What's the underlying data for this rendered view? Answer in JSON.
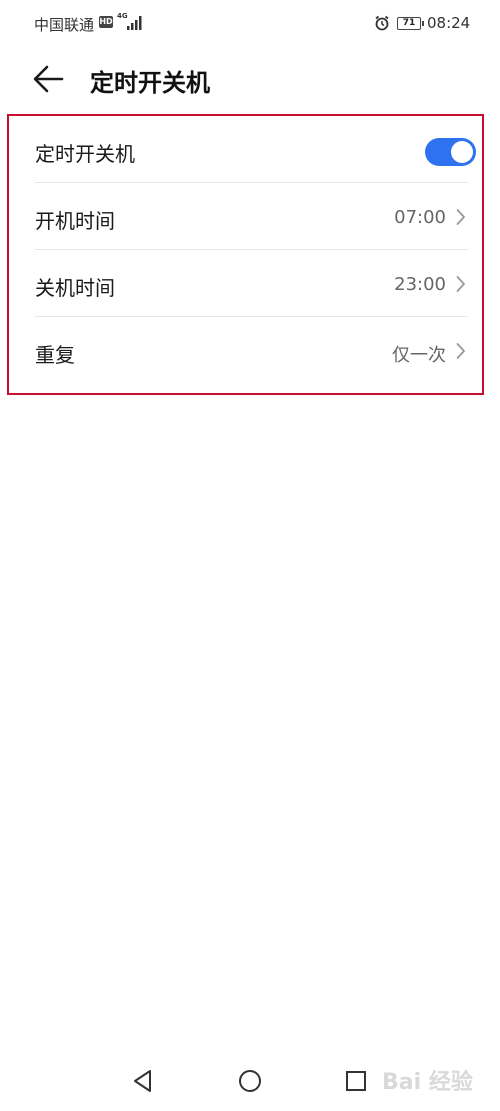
{
  "status_bar": {
    "carrier": "中国联通",
    "hd_badge": "HD",
    "network_type": "4G",
    "battery_level": "71",
    "time": "08:24",
    "icons": [
      "signal-icon",
      "alarm-icon",
      "battery-icon"
    ]
  },
  "header": {
    "title": "定时开关机",
    "back_icon": "arrow-left-icon"
  },
  "settings": {
    "items": [
      {
        "label": "定时开关机",
        "control": "toggle",
        "enabled": true
      },
      {
        "label": "开机时间",
        "value": "07:00"
      },
      {
        "label": "关机时间",
        "value": "23:00"
      },
      {
        "label": "重复",
        "value": "仅一次"
      }
    ]
  },
  "nav_bar": {
    "icons": [
      "nav-back-icon",
      "nav-home-icon",
      "nav-recent-icon"
    ]
  },
  "watermark": "Bai 经验",
  "colors": {
    "accent": "#2e72f0",
    "highlight_border": "#c8102e"
  }
}
